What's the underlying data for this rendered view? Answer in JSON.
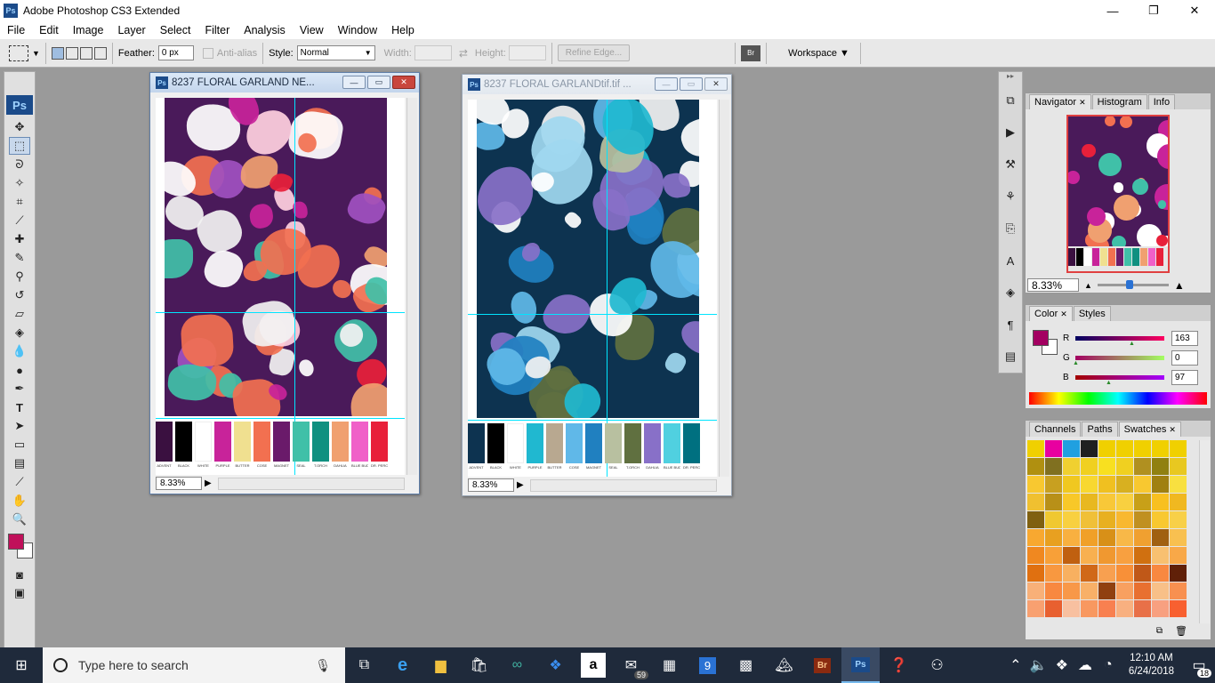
{
  "window": {
    "title": "Adobe Photoshop CS3 Extended",
    "app_badge": "Ps",
    "minimize": "—",
    "maximize": "❐",
    "close": "✕"
  },
  "menubar": {
    "items": [
      "File",
      "Edit",
      "Image",
      "Layer",
      "Select",
      "Filter",
      "Analysis",
      "View",
      "Window",
      "Help"
    ]
  },
  "options": {
    "feather_label": "Feather:",
    "feather_value": "0 px",
    "antialias_label": "Anti-alias",
    "style_label": "Style:",
    "style_value": "Normal",
    "width_label": "Width:",
    "height_label": "Height:",
    "refine_edge": "Refine Edge...",
    "workspace": "Workspace ▼"
  },
  "toolbox": {
    "logo": "Ps",
    "fg_color": "#c0105a"
  },
  "documents": [
    {
      "title": "8237 FLORAL GARLAND NE...",
      "zoom": "8.33%",
      "background": "#4a1a5a",
      "swatches": [
        "#3a1040",
        "#000000",
        "#ffffff",
        "#c8239a",
        "#f0e090",
        "#f27050",
        "#6a1a6a",
        "#40c0a8",
        "#109080",
        "#f0a070",
        "#f060c8",
        "#e8203a"
      ],
      "swatch_labels": [
        "ADVENT",
        "BLACK",
        "WHITE",
        "PURPLE",
        "BUTTER",
        "COSE",
        "MAGNET",
        "SEAL",
        "T.ORCH",
        "DAHLIA",
        "BLUE BUD",
        "DR. PERCUS"
      ]
    },
    {
      "title": "8237 FLORAL GARLANDtif.tif ...",
      "zoom": "8.33%",
      "background": "#0d3350",
      "swatches": [
        "#0d3350",
        "#000000",
        "#ffffff",
        "#20b8d0",
        "#b8a890",
        "#60b8e8",
        "#2080c0",
        "#b8c0a0",
        "#607040",
        "#8870c8",
        "#50d0e0",
        "#007080"
      ],
      "swatch_labels": [
        "ADVENT",
        "BLACK",
        "WHITE",
        "PURPLE",
        "BUTTER",
        "COSE",
        "MAGNET",
        "SEAL",
        "T.ORCH",
        "DAHLIA",
        "BLUE BUD",
        "DR. PERCUS"
      ]
    }
  ],
  "navigator_panel": {
    "tabs": [
      "Navigator",
      "Histogram",
      "Info"
    ],
    "zoom": "8.33%"
  },
  "color_panel": {
    "tabs": [
      "Color",
      "Styles"
    ],
    "fg": "#a30061",
    "r_label": "R",
    "r_value": "163",
    "g_label": "G",
    "g_value": "0",
    "b_label": "B",
    "b_value": "97"
  },
  "swatches_panel": {
    "tabs": [
      "Channels",
      "Paths",
      "Swatches"
    ],
    "colors": [
      "#f0d000",
      "#e800a0",
      "#20a0e0",
      "#202020",
      "#f0d000",
      "#f0d000",
      "#f0d000",
      "#f0d000",
      "#f0d000",
      "#b09010",
      "#807020",
      "#f0d030",
      "#f0d020",
      "#f8e020",
      "#f0d020",
      "#b09020",
      "#908010",
      "#e8c820",
      "#f8c830",
      "#c8a020",
      "#f0c820",
      "#f8d830",
      "#f0c020",
      "#d8b020",
      "#f8c830",
      "#a08010",
      "#f8e040",
      "#f0c030",
      "#b89018",
      "#f8c828",
      "#e8b820",
      "#f8c838",
      "#f8d040",
      "#c8a018",
      "#f8c020",
      "#f0b820",
      "#806010",
      "#f0c830",
      "#f8d040",
      "#f0c038",
      "#e8b020",
      "#f8b830",
      "#c09020",
      "#f8c830",
      "#f8d048",
      "#f8a830",
      "#e8a020",
      "#f8b040",
      "#f0a028",
      "#d89018",
      "#f8b848",
      "#f0a030",
      "#a06010",
      "#f8c050",
      "#f08820",
      "#f8a038",
      "#c06010",
      "#f8b050",
      "#f09830",
      "#f8a040",
      "#d07010",
      "#f8c070",
      "#f8a848",
      "#e07010",
      "#f89840",
      "#f8b060",
      "#d06818",
      "#f8a050",
      "#f89038",
      "#c05818",
      "#f88840",
      "#602008",
      "#f8b078",
      "#f88840",
      "#f89848",
      "#f8b068",
      "#904010",
      "#f8a060",
      "#e87030",
      "#f8c088",
      "#f89050",
      "#f8a070",
      "#e86030",
      "#f8c0a0",
      "#f89860",
      "#f88050",
      "#f8b080",
      "#e87048",
      "#f8a080",
      "#f86030"
    ]
  },
  "taskbar": {
    "search_placeholder": "Type here to search",
    "time": "12:10 AM",
    "date": "6/24/2018",
    "mail_badge": "59",
    "calendar_day": "9",
    "notification_count": "18"
  }
}
